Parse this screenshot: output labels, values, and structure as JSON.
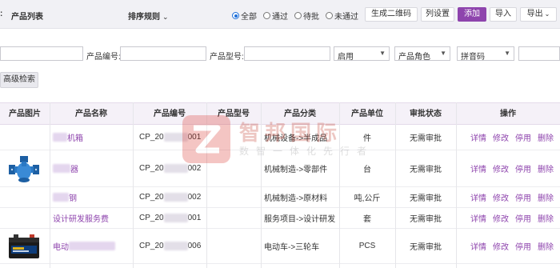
{
  "toolbar": {
    "title_prefix": ":",
    "title": "产品列表",
    "sort_label": "排序规则",
    "radios": [
      {
        "label": "全部",
        "checked": true
      },
      {
        "label": "通过",
        "checked": false
      },
      {
        "label": "待批",
        "checked": false
      },
      {
        "label": "未通过",
        "checked": false
      }
    ],
    "buttons": {
      "qrcode": "生成二维码",
      "columns": "列设置",
      "add": "添加",
      "import": "导入",
      "export": "导出"
    }
  },
  "filters": {
    "code_label": "产品编号:",
    "model_label": "产品型号:",
    "status_select": "启用",
    "role_select": "产品角色",
    "pinyin_select": "拼音码",
    "advanced_button": "高级检索"
  },
  "table": {
    "headers": {
      "image": "产品图片",
      "name": "产品名称",
      "code": "产品编号",
      "model": "产品型号",
      "category": "产品分类",
      "unit": "产品单位",
      "audit": "审批状态",
      "ops": "操作"
    },
    "rows": [
      {
        "name": "机箱",
        "code_prefix": "CP_20",
        "code_suffix": "001",
        "category": "机械设备->半成品",
        "unit": "件",
        "audit": "无需审批"
      },
      {
        "name": "器",
        "code_prefix": "CP_20",
        "code_suffix": "002",
        "category": "机械制造->零部件",
        "unit": "台",
        "audit": "无需审批"
      },
      {
        "name": "钢",
        "code_prefix": "CP_20",
        "code_suffix": "002",
        "category": "机械制造->原材料",
        "unit": "吨,公斤",
        "audit": "无需审批"
      },
      {
        "name": "设计研发服务费",
        "code_prefix": "CP_20",
        "code_suffix": "001",
        "category": "服务项目->设计研发",
        "unit": "套",
        "audit": "无需审批"
      },
      {
        "name": "电动",
        "code_prefix": "CP_20",
        "code_suffix": "006",
        "category": "电动车->三轮车",
        "unit": "PCS",
        "audit": "无需审批"
      }
    ],
    "ops": [
      "详情",
      "修改",
      "停用",
      "删除"
    ]
  },
  "watermark": {
    "text": "智邦国际",
    "sub": "数智一体化先行者"
  },
  "colors": {
    "accent": "#8e44ad",
    "radio_accent": "#1e6fd9",
    "header_bg": "#f5f1f8"
  }
}
